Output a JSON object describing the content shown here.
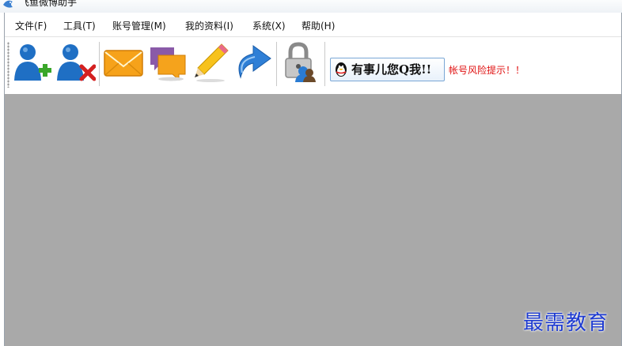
{
  "window": {
    "title": "飞鱼微博助手"
  },
  "menu": [
    {
      "label": "文件(F)"
    },
    {
      "label": "工具(T)"
    },
    {
      "label": "账号管理(M)"
    },
    {
      "label": "我的资料(I)"
    },
    {
      "label": "系统(X)"
    },
    {
      "label": "帮助(H)"
    }
  ],
  "toolbar": {
    "buttons": [
      {
        "icon": "add-user-icon"
      },
      {
        "icon": "remove-user-icon"
      },
      {
        "icon": "mail-icon"
      },
      {
        "icon": "chat-icon"
      },
      {
        "icon": "pencil-icon"
      },
      {
        "icon": "redo-icon"
      },
      {
        "icon": "lock-user-icon"
      }
    ],
    "qq_banner": "有事儿您Q我!!",
    "risk_notice": "帐号风险提示！！"
  },
  "watermark": "最需教育",
  "colors": {
    "client_area": "#a9a9a9",
    "risk_text": "#e01010",
    "watermark": "#1e3bd1",
    "user_blue": "#1f6fc4",
    "add_green": "#3aa62a",
    "remove_red": "#d42020"
  }
}
